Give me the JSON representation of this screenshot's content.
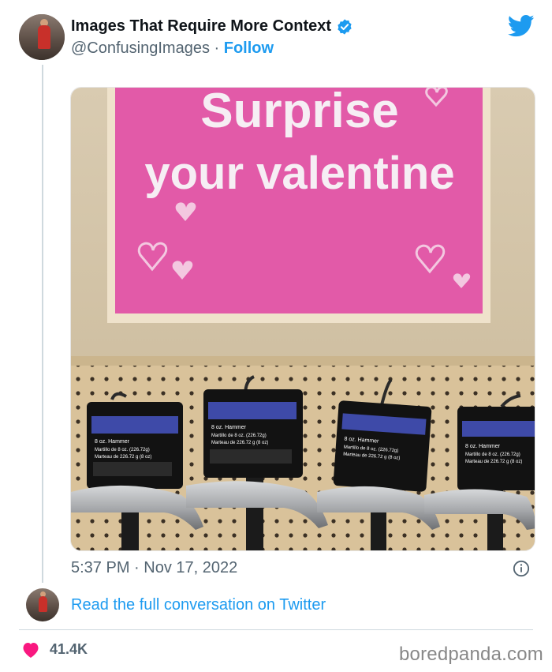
{
  "account": {
    "display_name": "Images That Require More Context",
    "handle": "@ConfusingImages",
    "separator": "·",
    "follow_label": "Follow"
  },
  "media": {
    "sign_line1": "Surprise",
    "sign_line2": "your valentine",
    "product_label_line1": "8 oz. Hammer",
    "product_label_line2": "Martillo de 8 oz. (226.72g)",
    "product_label_line3": "Marteau de 226.72 g (8 oz)"
  },
  "timestamp": "5:37 PM · Nov 17, 2022",
  "reply_link": "Read the full conversation on Twitter",
  "likes": "41.4K",
  "watermark": "boredpanda.com",
  "colors": {
    "twitter_blue": "#1d9bf0",
    "like_red": "#f91880",
    "sign_pink": "#e25aa8"
  },
  "icons": [
    "verified-badge-icon",
    "twitter-bird-icon",
    "info-icon",
    "heart-icon"
  ]
}
